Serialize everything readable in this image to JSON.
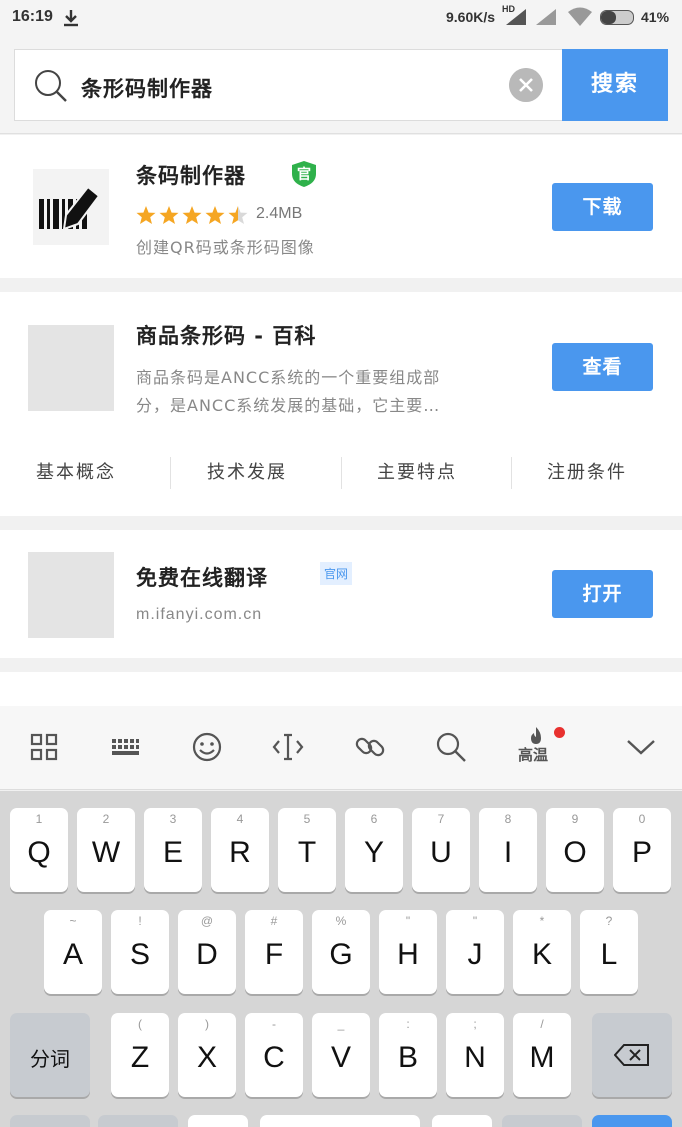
{
  "status": {
    "time": "16:19",
    "speed": "9.60K/s",
    "hd": "HD",
    "battery": "41%"
  },
  "search": {
    "query": "条形码制作器",
    "button": "搜索"
  },
  "results": {
    "app": {
      "title": "条码制作器",
      "official_badge": "官",
      "rating": 4.5,
      "size": "2.4MB",
      "description": "创建QR码或条形码图像",
      "button": "下载"
    },
    "baike": {
      "title": "商品条形码 - 百科",
      "snippet_line1": "商品条码是ANCC系统的一个重要组成部",
      "snippet_line2": "分，是ANCC系统发展的基础，它主要…",
      "button": "查看",
      "links": [
        "基本概念",
        "技术发展",
        "主要特点",
        "注册条件"
      ]
    },
    "site": {
      "title": "免费在线翻译",
      "tag": "官网",
      "url": "m.ifanyi.com.cn",
      "button": "打开"
    }
  },
  "keyboard_toolbar": {
    "hot_label": "高温",
    "icons": [
      "grid-icon",
      "keyboard-icon",
      "emoji-icon",
      "cursor-icon",
      "link-icon",
      "search-icon",
      "fire-icon",
      "chevron-down-icon"
    ]
  },
  "keyboard": {
    "row1": [
      {
        "num": "1",
        "ch": "Q"
      },
      {
        "num": "2",
        "ch": "W"
      },
      {
        "num": "3",
        "ch": "E"
      },
      {
        "num": "4",
        "ch": "R"
      },
      {
        "num": "5",
        "ch": "T"
      },
      {
        "num": "6",
        "ch": "Y"
      },
      {
        "num": "7",
        "ch": "U"
      },
      {
        "num": "8",
        "ch": "I"
      },
      {
        "num": "9",
        "ch": "O"
      },
      {
        "num": "0",
        "ch": "P"
      }
    ],
    "row2": [
      {
        "num": "~",
        "ch": "A"
      },
      {
        "num": "!",
        "ch": "S"
      },
      {
        "num": "@",
        "ch": "D"
      },
      {
        "num": "#",
        "ch": "F"
      },
      {
        "num": "%",
        "ch": "G"
      },
      {
        "num": "\"",
        "ch": "H"
      },
      {
        "num": "\"",
        "ch": "J"
      },
      {
        "num": "*",
        "ch": "K"
      },
      {
        "num": "?",
        "ch": "L"
      }
    ],
    "row3": [
      {
        "num": "(",
        "ch": "Z"
      },
      {
        "num": ")",
        "ch": "X"
      },
      {
        "num": "-",
        "ch": "C"
      },
      {
        "num": "_",
        "ch": "V"
      },
      {
        "num": ":",
        "ch": "B"
      },
      {
        "num": ";",
        "ch": "N"
      },
      {
        "num": "/",
        "ch": "M"
      }
    ],
    "fenci": "分词"
  }
}
